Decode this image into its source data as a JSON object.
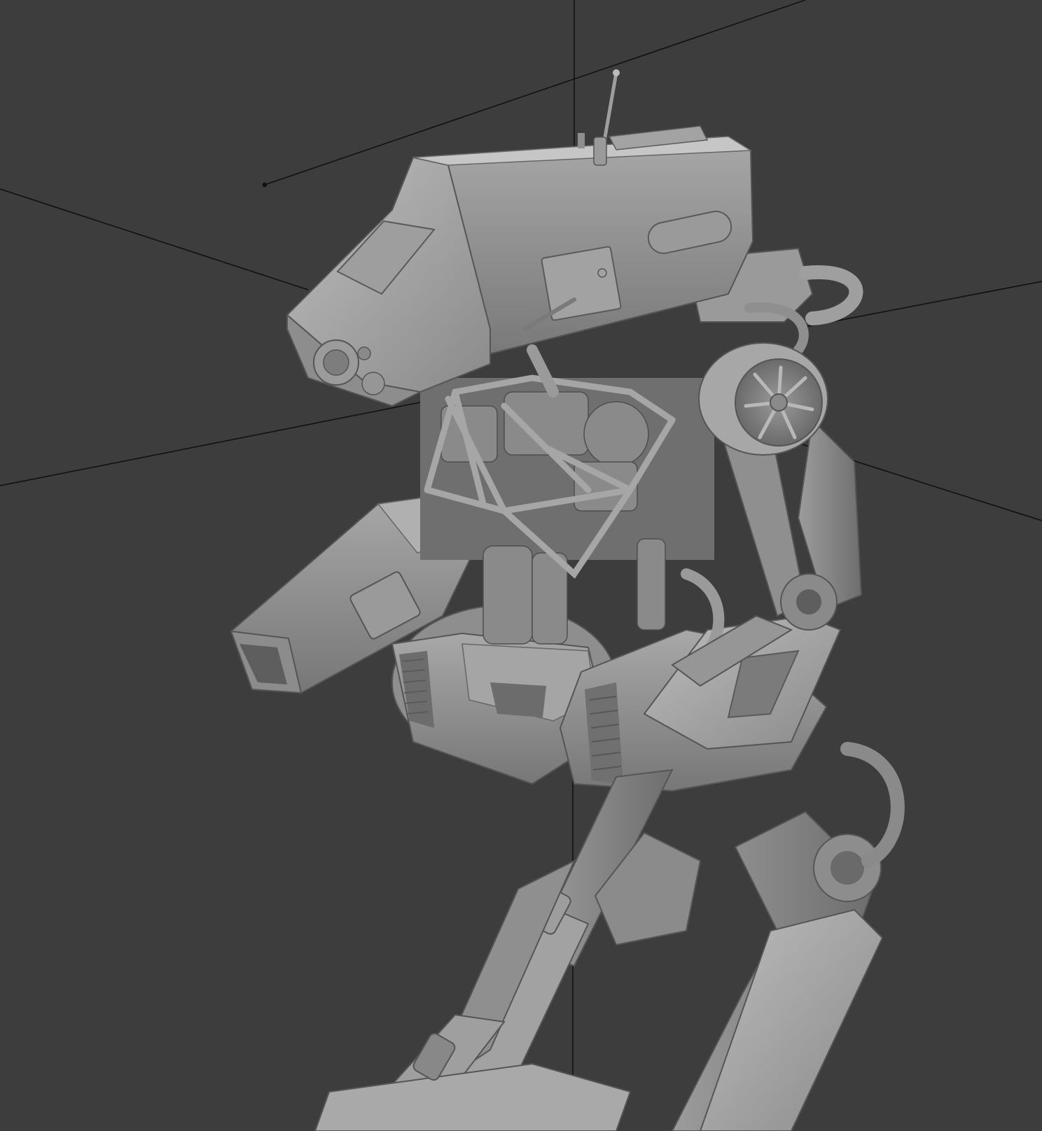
{
  "viewport": {
    "background_color": "#3d3d3d",
    "shading": "solid",
    "subject": "mech-walker-robot-model"
  },
  "colors": {
    "mesh_light": "#b4b4b4",
    "mesh_mid": "#8f8f8f",
    "mesh_dark": "#5a5a5a",
    "wire_line": "#111111"
  }
}
